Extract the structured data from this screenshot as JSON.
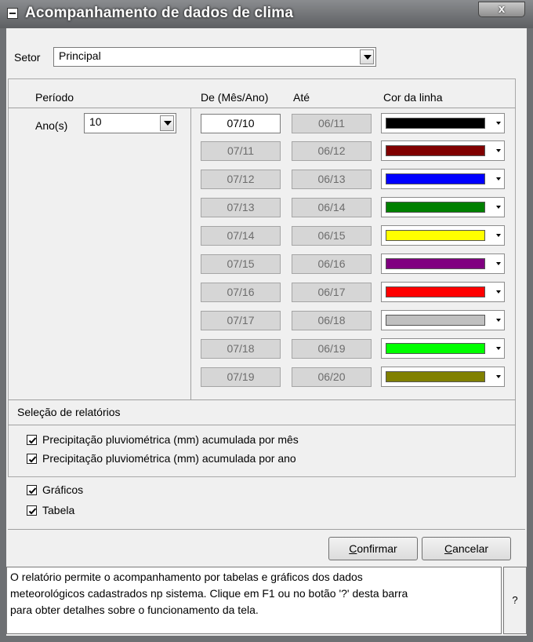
{
  "window": {
    "title": "Acompanhamento de dados  de clima",
    "close_glyph": "x"
  },
  "setor": {
    "label": "Setor",
    "value": "Principal"
  },
  "periodo": {
    "header_periodo": "Período",
    "header_de": "De (Mês/Ano)",
    "header_ate": "Até",
    "header_cor": "Cor da linha",
    "anos_label": "Ano(s)",
    "anos_value": "10",
    "rows": [
      {
        "de": "07/10",
        "ate": "06/11",
        "color": "#000000"
      },
      {
        "de": "07/11",
        "ate": "06/12",
        "color": "#800000"
      },
      {
        "de": "07/12",
        "ate": "06/13",
        "color": "#0000ff"
      },
      {
        "de": "07/13",
        "ate": "06/14",
        "color": "#008000"
      },
      {
        "de": "07/14",
        "ate": "06/15",
        "color": "#ffff00"
      },
      {
        "de": "07/15",
        "ate": "06/16",
        "color": "#800080"
      },
      {
        "de": "07/16",
        "ate": "06/17",
        "color": "#ff0000"
      },
      {
        "de": "07/17",
        "ate": "06/18",
        "color": "#c0c0c0"
      },
      {
        "de": "07/18",
        "ate": "06/19",
        "color": "#00ff00"
      },
      {
        "de": "07/19",
        "ate": "06/20",
        "color": "#808000"
      }
    ]
  },
  "relatorios": {
    "header": "Seleção de relatórios",
    "items": [
      {
        "label": "Precipitação pluviométrica (mm) acumulada por mês",
        "checked": true
      },
      {
        "label": "Precipitação pluviométrica (mm) acumulada por ano",
        "checked": true
      }
    ]
  },
  "options": [
    {
      "label": "Gráficos",
      "checked": true
    },
    {
      "label": "Tabela",
      "checked": true
    }
  ],
  "buttons": {
    "confirm_mnemonic": "C",
    "confirm_rest": "onfirmar",
    "cancel_mnemonic": "C",
    "cancel_rest": "ancelar"
  },
  "hint": {
    "line1": "O relatório permite o acompanhamento por tabelas e gráficos dos dados",
    "line2": "meteorológicos cadastrados np sistema. Clique em F1 ou no botão '?' desta barra",
    "line3": "para obter detalhes sobre o funcionamento da tela.",
    "help": "?"
  }
}
